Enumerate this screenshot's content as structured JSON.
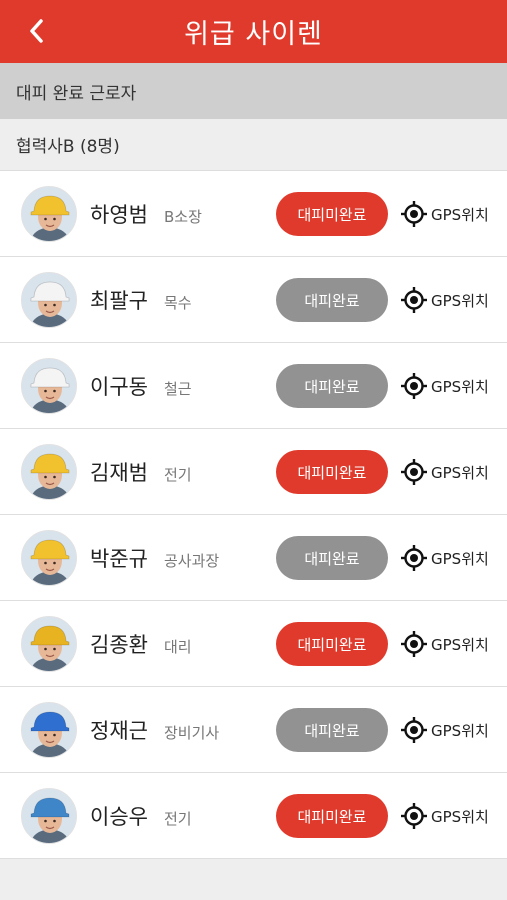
{
  "header": {
    "title": "위급 사이렌",
    "back_icon": "chevron-left-icon"
  },
  "section": {
    "label": "대피 완료 근로자"
  },
  "group": {
    "label": "협력사B (8명)"
  },
  "colors": {
    "accent": "#e03a2c",
    "done_gray": "#929292"
  },
  "workers": [
    {
      "name": "하영범",
      "role": "B소장",
      "status": "대피미완료",
      "evacuated": false,
      "gps": "GPS위치",
      "helmet": "#f2c12e"
    },
    {
      "name": "최팔구",
      "role": "목수",
      "status": "대피완료",
      "evacuated": true,
      "gps": "GPS위치",
      "helmet": "#f4f4f4"
    },
    {
      "name": "이구동",
      "role": "철근",
      "status": "대피완료",
      "evacuated": true,
      "gps": "GPS위치",
      "helmet": "#f4f4f4"
    },
    {
      "name": "김재범",
      "role": "전기",
      "status": "대피미완료",
      "evacuated": false,
      "gps": "GPS위치",
      "helmet": "#f2c12e"
    },
    {
      "name": "박준규",
      "role": "공사과장",
      "status": "대피완료",
      "evacuated": true,
      "gps": "GPS위치",
      "helmet": "#f2c12e"
    },
    {
      "name": "김종환",
      "role": "대리",
      "status": "대피미완료",
      "evacuated": false,
      "gps": "GPS위치",
      "helmet": "#e8b321"
    },
    {
      "name": "정재근",
      "role": "장비기사",
      "status": "대피완료",
      "evacuated": true,
      "gps": "GPS위치",
      "helmet": "#2f6fcf"
    },
    {
      "name": "이승우",
      "role": "전기",
      "status": "대피미완료",
      "evacuated": false,
      "gps": "GPS위치",
      "helmet": "#3f86c9"
    }
  ]
}
